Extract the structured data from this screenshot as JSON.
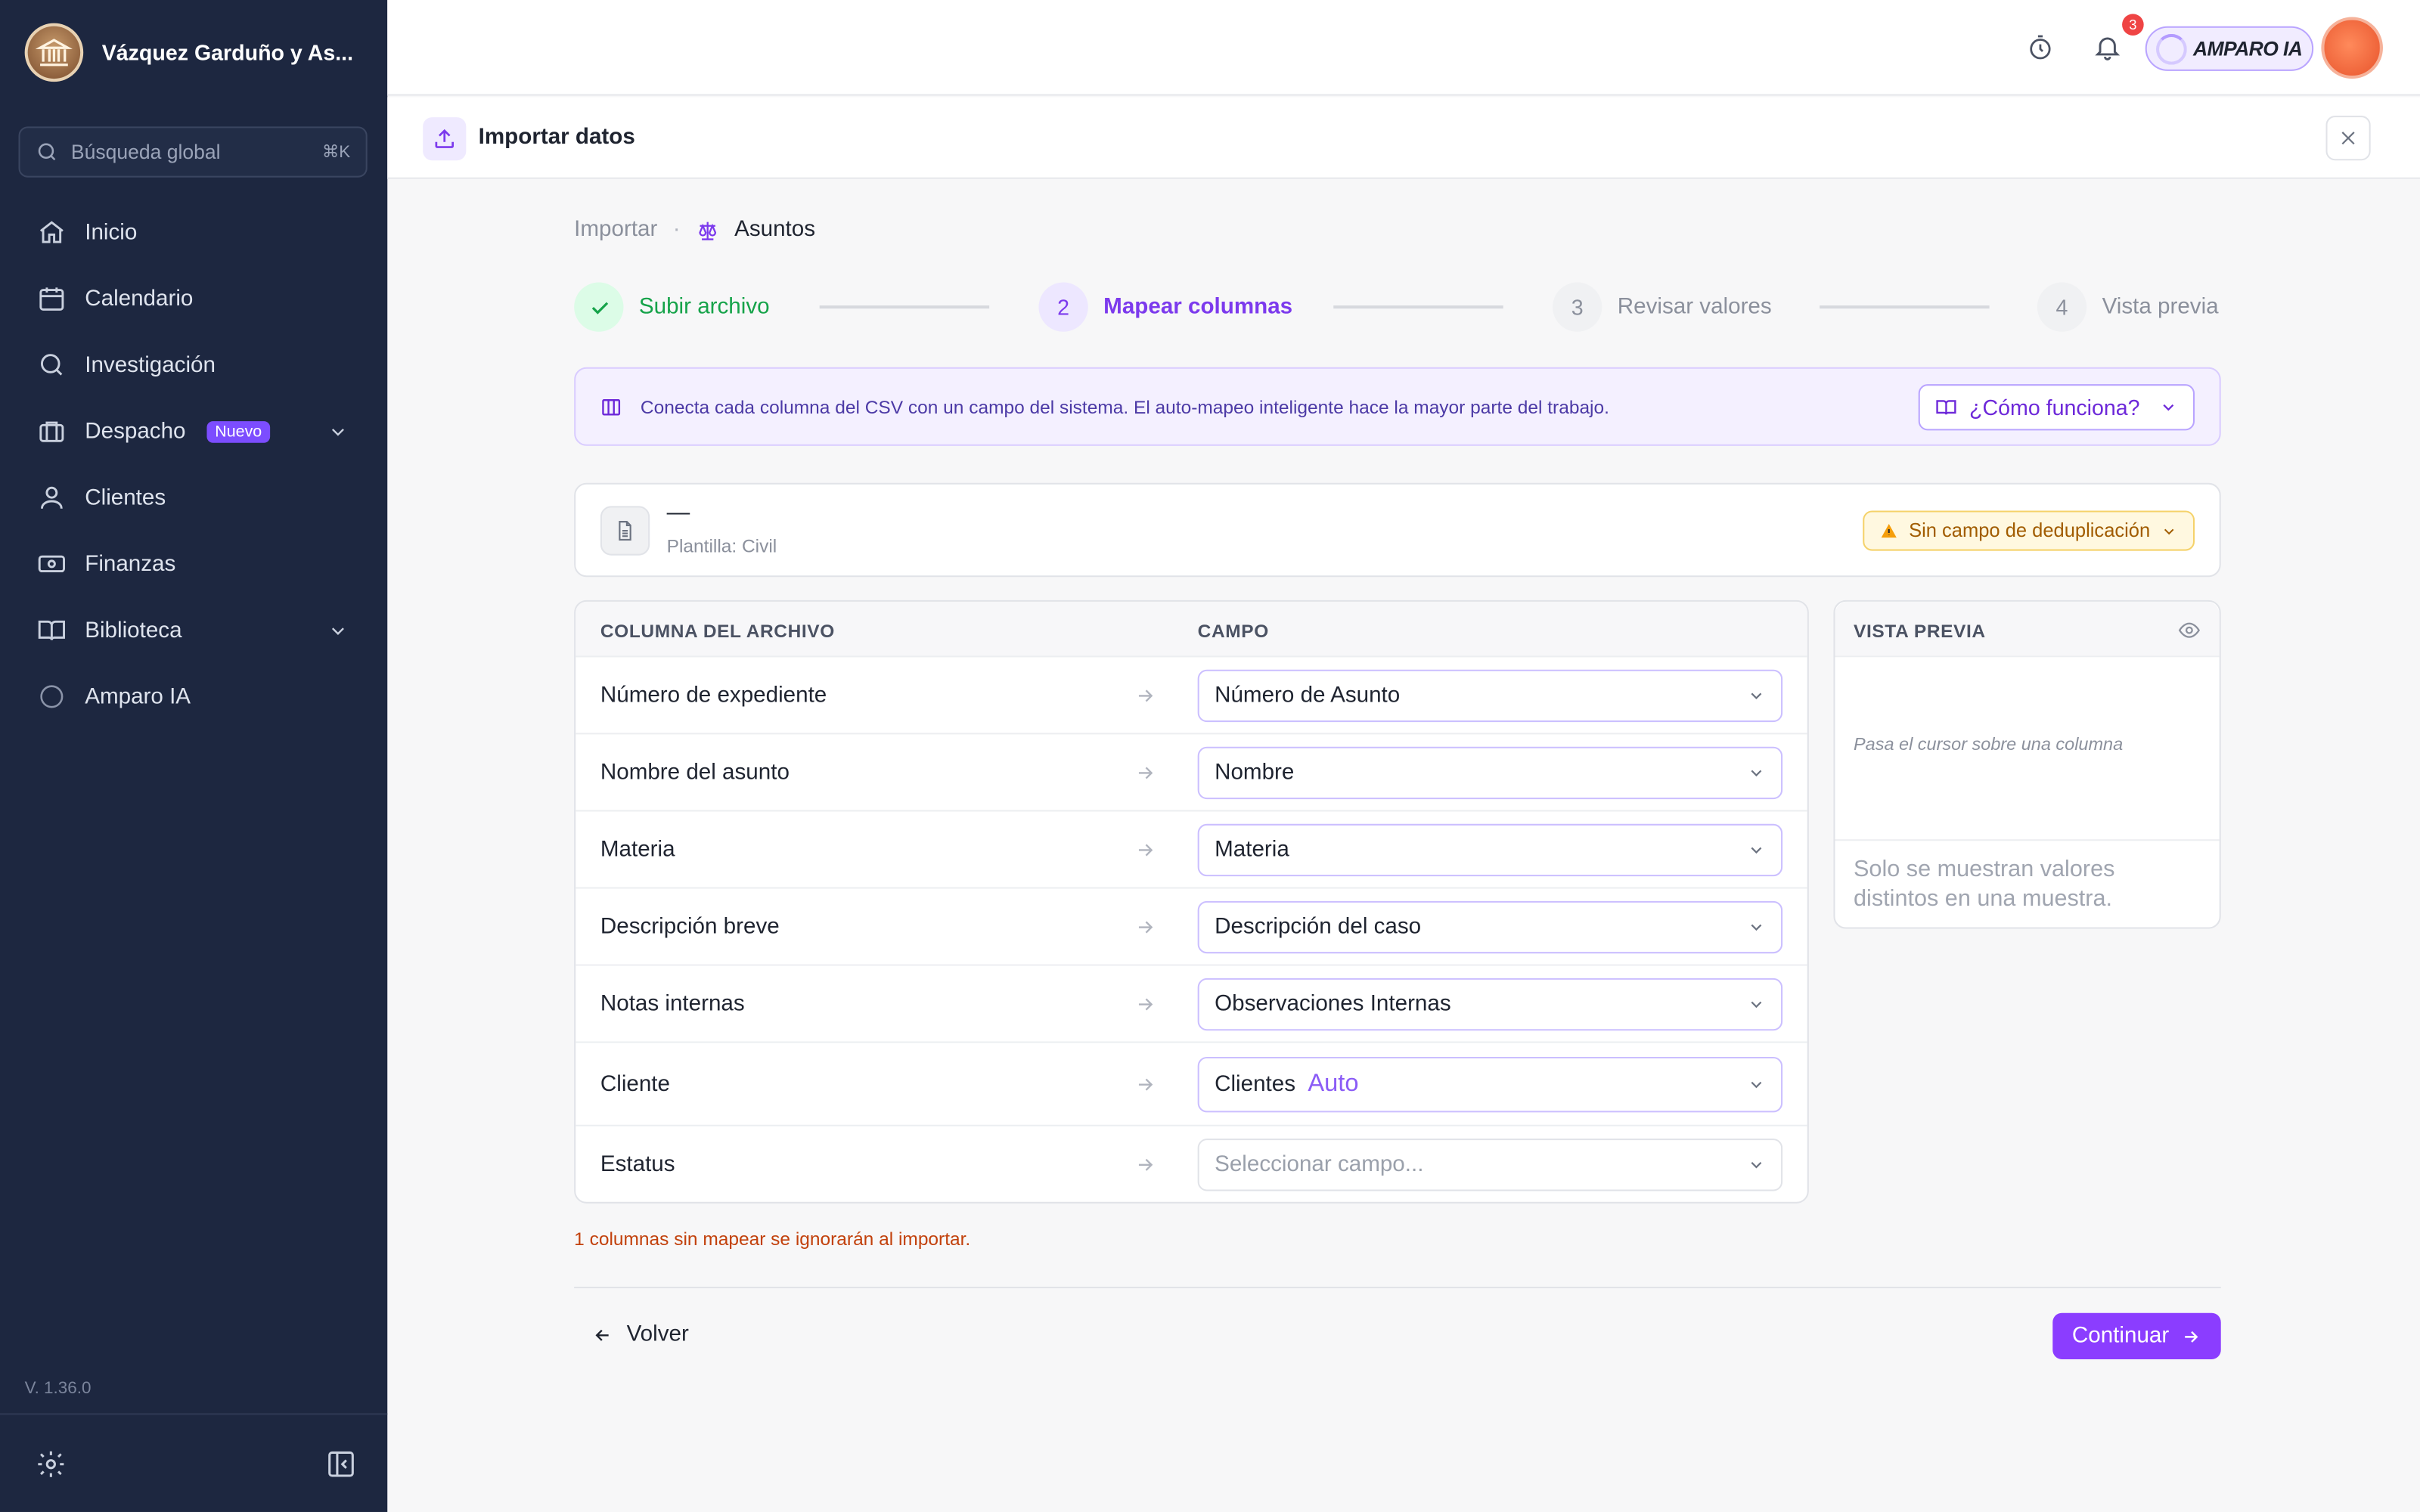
{
  "sidebar": {
    "brand": "Vázquez Garduño y As...",
    "search_placeholder": "Búsqueda global",
    "search_shortcut": "⌘K",
    "items": [
      {
        "label": "Inicio",
        "icon": "home-icon"
      },
      {
        "label": "Calendario",
        "icon": "calendar-icon"
      },
      {
        "label": "Investigación",
        "icon": "search-icon"
      },
      {
        "label": "Despacho",
        "icon": "briefcase-icon",
        "badge": "Nuevo",
        "expandable": true
      },
      {
        "label": "Clientes",
        "icon": "user-icon"
      },
      {
        "label": "Finanzas",
        "icon": "money-icon"
      },
      {
        "label": "Biblioteca",
        "icon": "book-icon",
        "expandable": true
      },
      {
        "label": "Amparo IA",
        "icon": "ai-ring-icon"
      }
    ],
    "version": "V. 1.36.0"
  },
  "topbar": {
    "notification_count": "3",
    "assistant_label": "AMPARO IA"
  },
  "modal": {
    "title": "Importar datos"
  },
  "breadcrumb": {
    "root": "Importar",
    "separator": "·",
    "current": "Asuntos"
  },
  "steps": [
    {
      "number": "1",
      "label": "Subir archivo",
      "state": "done"
    },
    {
      "number": "2",
      "label": "Mapear columnas",
      "state": "active"
    },
    {
      "number": "3",
      "label": "Revisar valores",
      "state": "pending"
    },
    {
      "number": "4",
      "label": "Vista previa",
      "state": "pending"
    }
  ],
  "info": {
    "text": "Conecta cada columna del CSV con un campo del sistema. El auto-mapeo inteligente hace la mayor parte del trabajo.",
    "help_button": "¿Cómo funciona?"
  },
  "file": {
    "name": "—",
    "template": "Plantilla: Civil",
    "dedup_label": "Sin campo de deduplicación"
  },
  "mapping": {
    "header_column": "COLUMNA DEL ARCHIVO",
    "header_field": "CAMPO",
    "rows": [
      {
        "column": "Número de expediente",
        "field": "Número de Asunto",
        "auto": ""
      },
      {
        "column": "Nombre del asunto",
        "field": "Nombre",
        "auto": ""
      },
      {
        "column": "Materia",
        "field": "Materia",
        "auto": ""
      },
      {
        "column": "Descripción breve",
        "field": "Descripción del caso",
        "auto": ""
      },
      {
        "column": "Notas internas",
        "field": "Observaciones Internas",
        "auto": ""
      },
      {
        "column": "Cliente",
        "field": "Clientes",
        "auto": "Auto"
      },
      {
        "column": "Estatus",
        "field": "",
        "placeholder": "Seleccionar campo...",
        "auto": ""
      }
    ]
  },
  "preview": {
    "title": "VISTA PREVIA",
    "hint": "Pasa el cursor sobre una columna",
    "footer": "Solo se muestran valores distintos en una muestra."
  },
  "unmapped_warning": "1 columnas sin mapear se ignorarán al importar.",
  "footer": {
    "back_label": "Volver",
    "next_label": "Continuar"
  },
  "colors": {
    "sidebar_bg": "#1d2740",
    "accent": "#8b3dff",
    "success": "#16a34a",
    "warning": "#a15c00"
  }
}
